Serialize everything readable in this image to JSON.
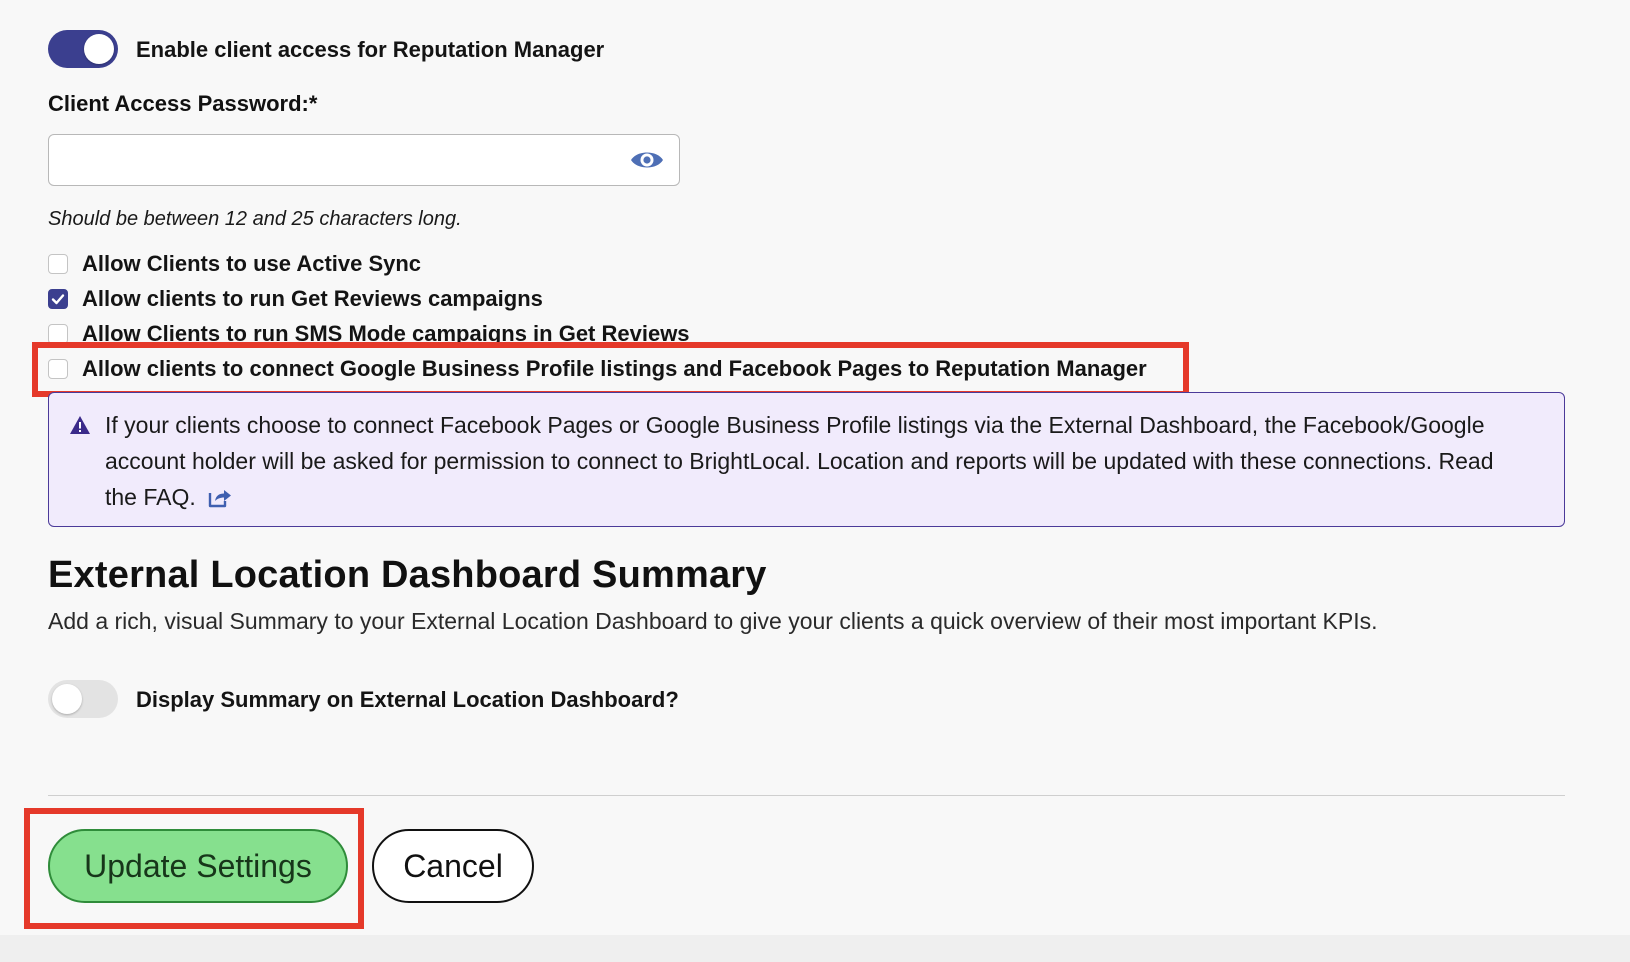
{
  "client_access": {
    "toggle_label": "Enable client access for Reputation Manager",
    "toggle_on": true,
    "password_label": "Client Access Password:*",
    "password_value": "",
    "password_hint": "Should be between 12 and 25 characters long."
  },
  "options": [
    {
      "label": "Allow Clients to use Active Sync",
      "checked": false
    },
    {
      "label": "Allow clients to run Get Reviews campaigns",
      "checked": true
    },
    {
      "label": "Allow Clients to run SMS Mode campaigns in Get Reviews",
      "checked": false
    },
    {
      "label": "Allow clients to connect Google Business Profile listings and Facebook Pages to Reputation Manager",
      "checked": false
    }
  ],
  "notice": {
    "text": "If your clients choose to connect Facebook Pages or Google Business Profile listings via the External Dashboard, the Facebook/Google account holder will be asked for permission to connect to BrightLocal. Location and reports will be updated with these connections.",
    "link_text": "Read the FAQ."
  },
  "summary_section": {
    "title": "External Location Dashboard Summary",
    "description": "Add a rich, visual Summary to your External Location Dashboard to give your clients a quick overview of their most important KPIs.",
    "toggle_label": "Display Summary on External Location Dashboard?",
    "toggle_on": false
  },
  "actions": {
    "update_label": "Update Settings",
    "cancel_label": "Cancel"
  },
  "colors": {
    "toggle_on": "#3b3f8f",
    "toggle_off": "#e3e3e3",
    "notice_bg": "#f1ebfc",
    "notice_border": "#4b3a99",
    "update_button": "#86e08e",
    "highlight": "#e5392a"
  },
  "icons": {
    "password_reveal": "eye-icon",
    "notice": "warning-triangle-icon",
    "faq_link": "external-link-icon"
  }
}
